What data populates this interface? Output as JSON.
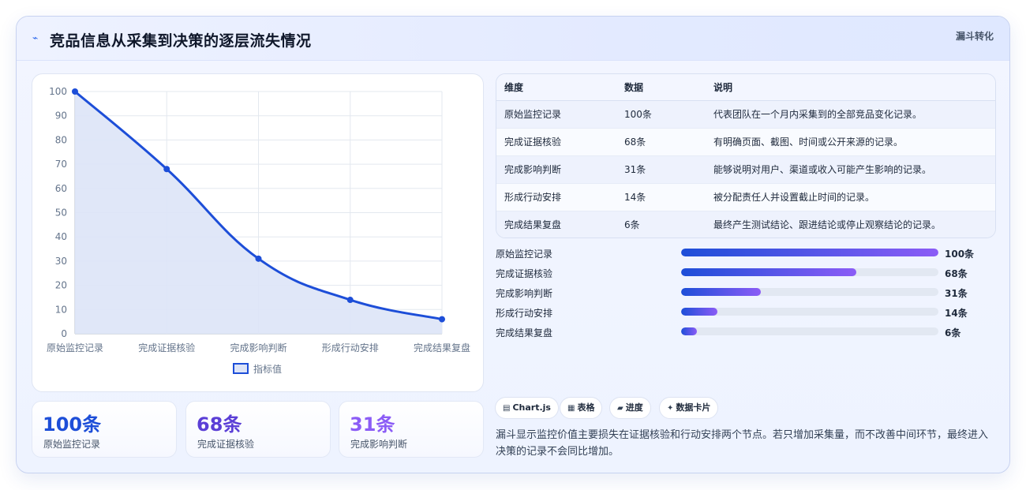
{
  "header": {
    "icon": "lightning-icon",
    "title": "竞品信息从采集到决策的逐层流失情况",
    "badge": "漏斗转化"
  },
  "colors": {
    "line": "#1d4ed8",
    "fill": "#dde4f7",
    "stat1": "#1d4ed8",
    "stat2": "#5b3fd6",
    "stat3": "#8b5cf6"
  },
  "chart_data": {
    "type": "line",
    "categories": [
      "原始监控记录",
      "完成证据核验",
      "完成影响判断",
      "形成行动安排",
      "完成结果复盘"
    ],
    "series": [
      {
        "name": "指标值",
        "values": [
          100,
          68,
          31,
          14,
          6
        ]
      }
    ],
    "ylim": [
      0,
      100
    ],
    "yticks": [
      0,
      10,
      20,
      30,
      40,
      50,
      60,
      70,
      80,
      90,
      100
    ],
    "grid": true,
    "legend": "bottom",
    "filled": true
  },
  "stats": [
    {
      "value": "100条",
      "label": "原始监控记录"
    },
    {
      "value": "68条",
      "label": "完成证据核验"
    },
    {
      "value": "31条",
      "label": "完成影响判断"
    }
  ],
  "table": {
    "headers": [
      "维度",
      "数据",
      "说明"
    ],
    "rows": [
      [
        "原始监控记录",
        "100条",
        "代表团队在一个月内采集到的全部竞品变化记录。"
      ],
      [
        "完成证据核验",
        "68条",
        "有明确页面、截图、时间或公开来源的记录。"
      ],
      [
        "完成影响判断",
        "31条",
        "能够说明对用户、渠道或收入可能产生影响的记录。"
      ],
      [
        "形成行动安排",
        "14条",
        "被分配责任人并设置截止时间的记录。"
      ],
      [
        "完成结果复盘",
        "6条",
        "最终产生测试结论、跟进结论或停止观察结论的记录。"
      ]
    ]
  },
  "progress": [
    {
      "label": "原始监控记录",
      "value": "100条",
      "fraction": 1.0
    },
    {
      "label": "完成证据核验",
      "value": "68条",
      "fraction": 0.68
    },
    {
      "label": "完成影响判断",
      "value": "31条",
      "fraction": 0.31
    },
    {
      "label": "形成行动安排",
      "value": "14条",
      "fraction": 0.14
    },
    {
      "label": "完成结果复盘",
      "value": "6条",
      "fraction": 0.06
    }
  ],
  "tags": [
    {
      "icon": "chart-icon",
      "glyph": "▤",
      "label": "Chart.js"
    },
    {
      "icon": "table-icon",
      "glyph": "▦",
      "label": "表格"
    },
    {
      "icon": "progress-icon",
      "glyph": "▰",
      "label": "进度"
    },
    {
      "icon": "card-icon",
      "glyph": "✦",
      "label": "数据卡片"
    }
  ],
  "summary": "漏斗显示监控价值主要损失在证据核验和行动安排两个节点。若只增加采集量，而不改善中间环节，最终进入决策的记录不会同比增加。"
}
